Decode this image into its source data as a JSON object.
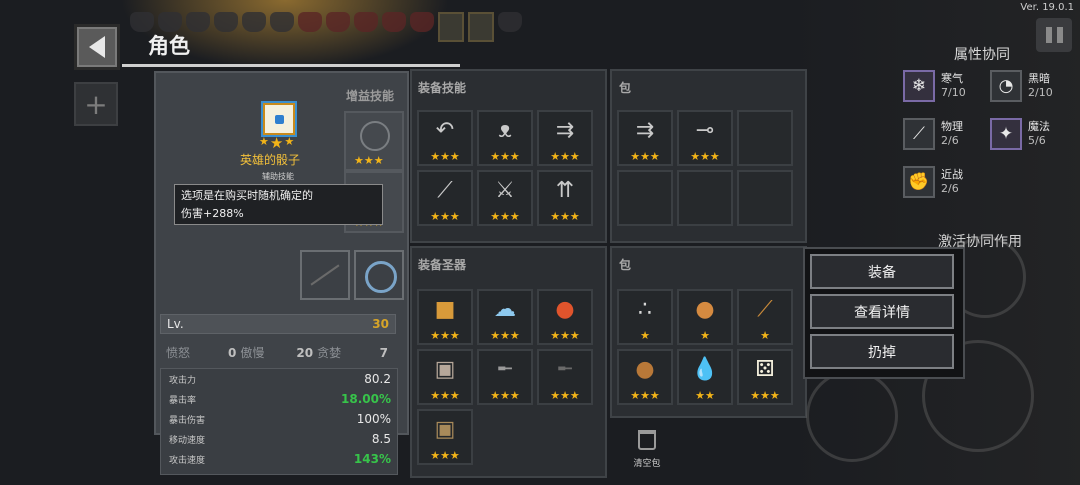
{
  "version": "Ver. 19.0.1",
  "header": {
    "title": "角色"
  },
  "character": {
    "buff_label": "增益技能",
    "selected_item": {
      "name": "英雄的骰子",
      "subtitle": "辅助技能",
      "tooltip_line1": "选项是在购买时随机确定的",
      "tooltip_line2": "伤害+288%"
    },
    "level": {
      "label": "Lv.",
      "value": "30"
    },
    "traits": {
      "anger_label": "愤怒",
      "anger": "0",
      "pride_label": "傲慢",
      "pride": "20",
      "greed_label": "贪婪",
      "greed": "7"
    },
    "stats": [
      {
        "label": "攻击力",
        "value": "80.2",
        "green": false
      },
      {
        "label": "暴击率",
        "value": "18.00%",
        "green": true
      },
      {
        "label": "暴击伤害",
        "value": "100%",
        "green": false
      },
      {
        "label": "移动速度",
        "value": "8.5",
        "green": false
      },
      {
        "label": "攻击速度",
        "value": "143%",
        "green": true
      }
    ]
  },
  "equip_skills": {
    "title": "装备技能",
    "slots": [
      {
        "icon": "grappling-hook-icon",
        "glyph": "↶",
        "stars": 3
      },
      {
        "icon": "bat-icon",
        "glyph": "ᴥ",
        "stars": 3
      },
      {
        "icon": "triple-arrow-icon",
        "glyph": "⇉",
        "stars": 3
      },
      {
        "icon": "feather-blade-icon",
        "glyph": "⟋",
        "stars": 3
      },
      {
        "icon": "frost-sword-icon",
        "glyph": "⚔",
        "stars": 3
      },
      {
        "icon": "arrow-volley-icon",
        "glyph": "⇈",
        "stars": 3
      }
    ]
  },
  "bag_top": {
    "title": "包",
    "slots": [
      {
        "icon": "triple-arrow-icon",
        "glyph": "⇉",
        "stars": 3
      },
      {
        "icon": "spear-icon",
        "glyph": "⊸",
        "stars": 3
      },
      {
        "icon": "",
        "glyph": "",
        "stars": 0
      },
      {
        "icon": "",
        "glyph": "",
        "stars": 0
      },
      {
        "icon": "",
        "glyph": "",
        "stars": 0
      },
      {
        "icon": "",
        "glyph": "",
        "stars": 0
      }
    ]
  },
  "equip_relics": {
    "title": "装备圣器",
    "slots": [
      {
        "icon": "red-cube-icon",
        "glyph": "■",
        "stars": 3,
        "color": "#d89a3a"
      },
      {
        "icon": "ice-cloud-icon",
        "glyph": "☁",
        "stars": 3,
        "color": "#8ec9ee"
      },
      {
        "icon": "fire-orb-icon",
        "glyph": "●",
        "stars": 3,
        "color": "#e0542c"
      },
      {
        "icon": "wooden-crate-icon",
        "glyph": "▣",
        "stars": 3,
        "color": "#b7a89a"
      },
      {
        "icon": "rifle-icon",
        "glyph": "╾",
        "stars": 3,
        "color": "#9a9a9a"
      },
      {
        "icon": "dark-gun-icon",
        "glyph": "╾",
        "stars": 3,
        "color": "#6a6a6a"
      },
      {
        "icon": "brown-crate-icon",
        "glyph": "▣",
        "stars": 3,
        "color": "#a88a5a"
      }
    ]
  },
  "bag_bottom": {
    "title": "包",
    "clear_label": "清空包",
    "slots": [
      {
        "icon": "small-orbs-icon",
        "glyph": "∴",
        "stars": 1,
        "color": "#d9d9d9"
      },
      {
        "icon": "cookie-icon",
        "glyph": "●",
        "stars": 1,
        "color": "#d58a40"
      },
      {
        "icon": "dagger-icon",
        "glyph": "⟋",
        "stars": 1,
        "color": "#c98a3a"
      },
      {
        "icon": "bronze-coin-icon",
        "glyph": "●",
        "stars": 3,
        "color": "#b87838"
      },
      {
        "icon": "water-drop-icon",
        "glyph": "💧",
        "stars": 2,
        "color": "#b8d8ee"
      },
      {
        "icon": "hero-dice-icon",
        "glyph": "⚄",
        "stars": 3,
        "color": "#f5f0dd"
      }
    ]
  },
  "context_menu": {
    "equip": "装备",
    "details": "查看详情",
    "discard": "扔掉"
  },
  "synergy": {
    "title": "属性协同",
    "items": [
      {
        "icon": "snowflake-icon",
        "glyph": "❄",
        "name": "寒气",
        "count": "7/10",
        "active": true
      },
      {
        "icon": "dark-swirl-icon",
        "glyph": "◔",
        "name": "黑暗",
        "count": "2/10",
        "active": false
      },
      {
        "icon": "sword-icon",
        "glyph": "⟋",
        "name": "物理",
        "count": "2/6",
        "active": false
      },
      {
        "icon": "magic-star-icon",
        "glyph": "✦",
        "name": "魔法",
        "count": "5/6",
        "active": true
      },
      {
        "icon": "fist-icon",
        "glyph": "✊",
        "name": "近战",
        "count": "2/6",
        "active": false
      }
    ],
    "activate_label": "激活协同作用"
  }
}
